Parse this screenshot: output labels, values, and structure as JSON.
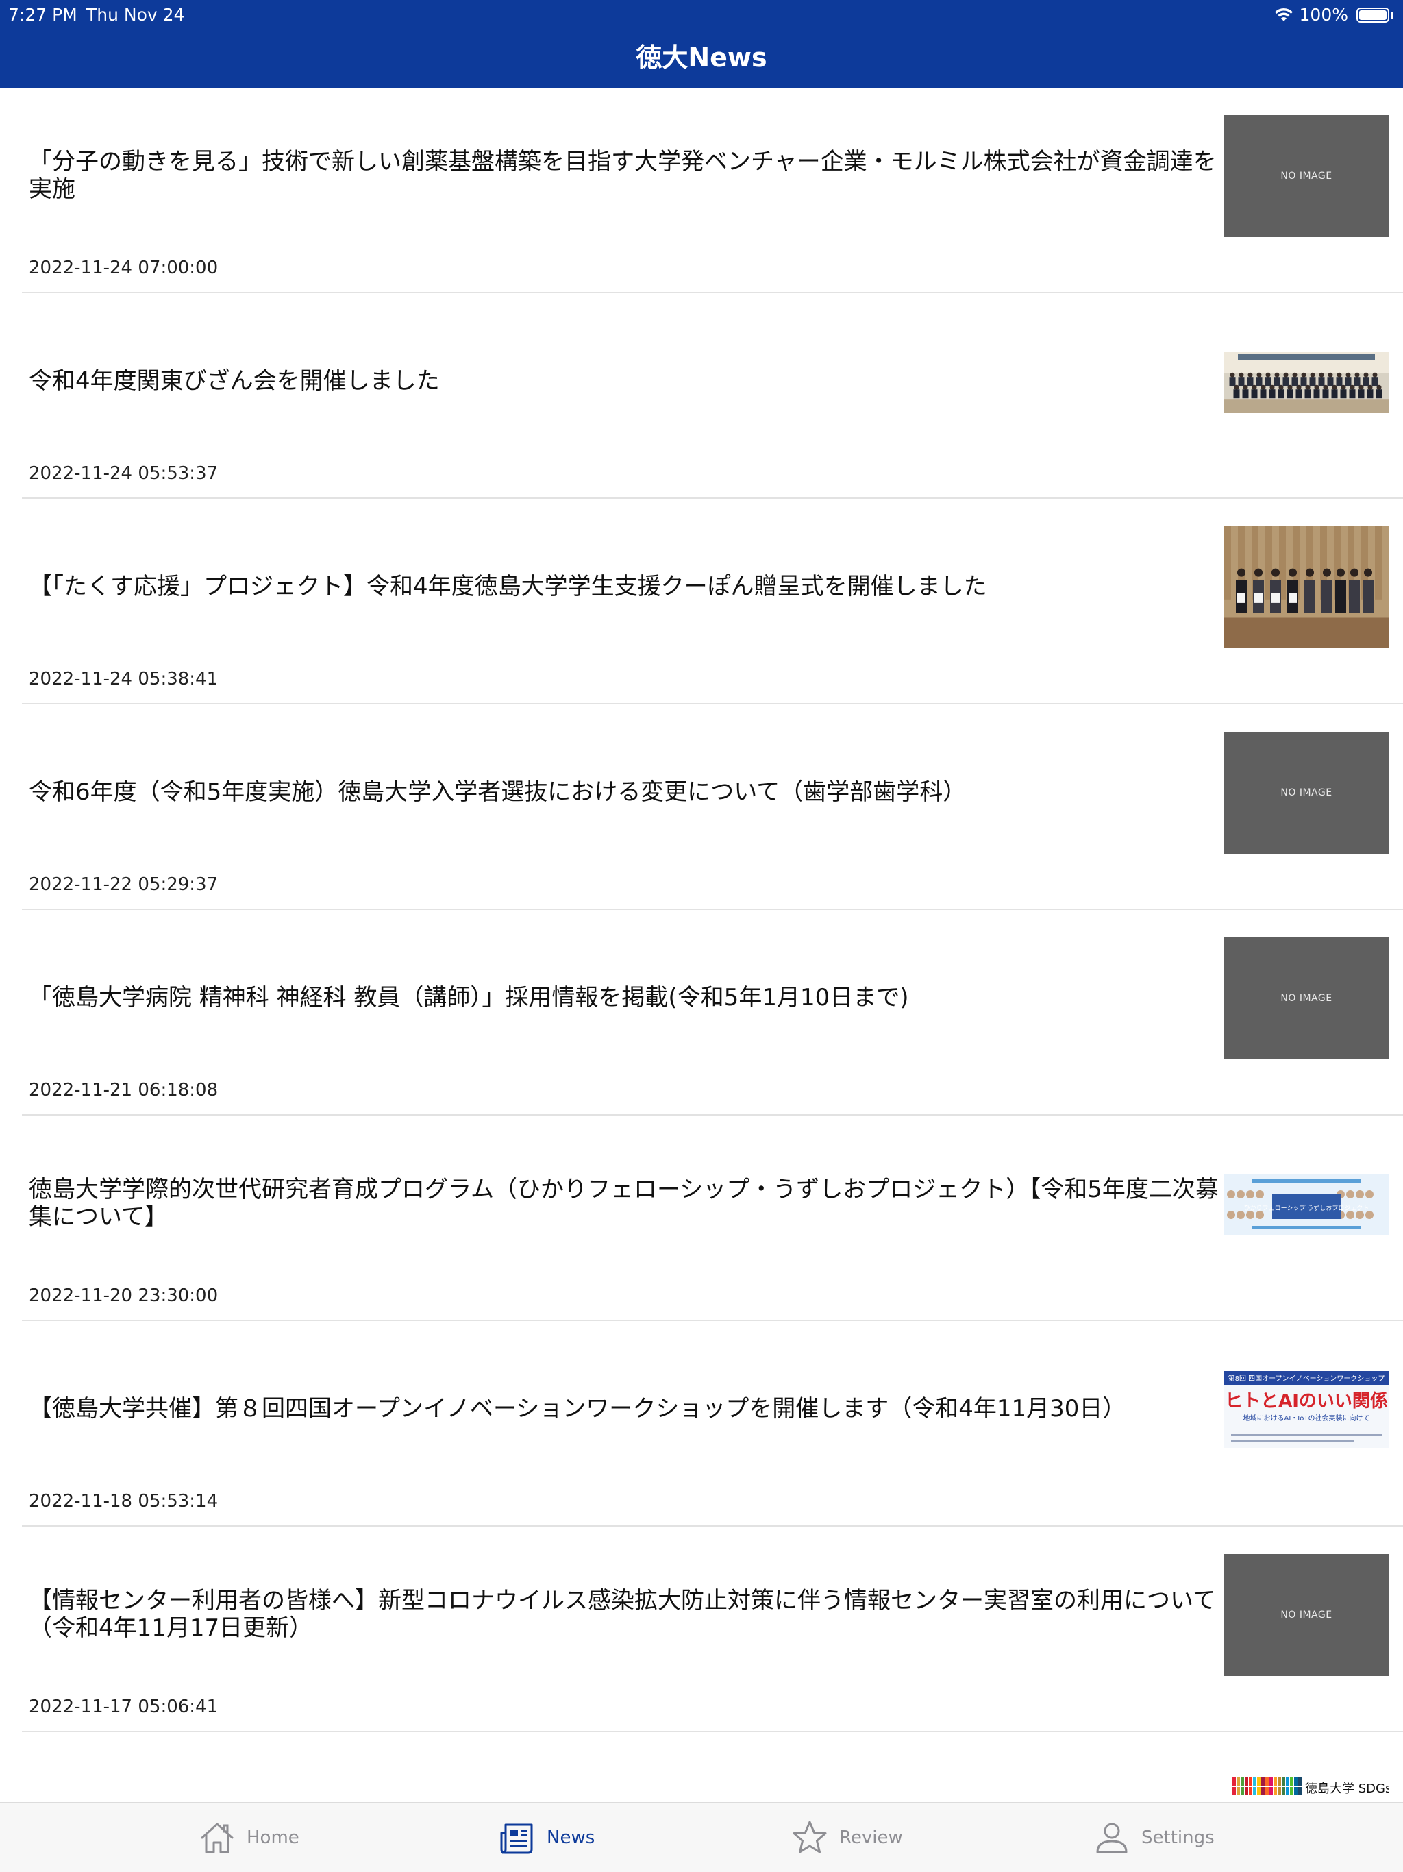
{
  "status_bar": {
    "time": "7:27 PM",
    "date": "Thu Nov 24",
    "battery": "100%",
    "battery_level": 1.0
  },
  "header": {
    "title": "徳大News"
  },
  "news": [
    {
      "title": "「分子の動きを見る」技術で新しい創薬基盤構築を目指す大学発ベンチャー企業・モルミル株式会社が資金調達を実施",
      "date": "2022-11-24 07:00:00",
      "thumb": "no-image",
      "thumb_label": "NO IMAGE"
    },
    {
      "title": "令和4年度関東びざん会を開催しました",
      "date": "2022-11-24 05:53:37",
      "thumb": "group-photo"
    },
    {
      "title": "【「たくす応援」プロジェクト】令和4年度徳島大学学生支援クーぽん贈呈式を開催しました",
      "date": "2022-11-24 05:38:41",
      "thumb": "ceremony-photo"
    },
    {
      "title": "令和6年度（令和5年度実施）徳島大学入学者選抜における変更について（歯学部歯学科）",
      "date": "2022-11-22 05:29:37",
      "thumb": "no-image",
      "thumb_label": "NO IMAGE"
    },
    {
      "title": "「徳島大学病院 精神科 神経科 教員（講師）」採用情報を掲載(令和5年1月10日まで)",
      "date": "2022-11-21 06:18:08",
      "thumb": "no-image",
      "thumb_label": "NO IMAGE"
    },
    {
      "title": "徳島大学学際的次世代研究者育成プログラム（ひかりフェローシップ・うずしおプロジェクト）【令和5年度二次募集について】",
      "date": "2022-11-20 23:30:00",
      "thumb": "fellowship-banner",
      "thumb_text": "ひかりフェローシップ うずしおプロジェクト"
    },
    {
      "title": "【徳島大学共催】第８回四国オープンイノベーションワークショップを開催します（令和4年11月30日）",
      "date": "2022-11-18 05:53:14",
      "thumb": "workshop-banner",
      "thumb_head": "第8回 四国オープンイノベーションワークショップ",
      "thumb_main": "ヒトとAIのいい関係",
      "thumb_sub": "地域におけるAI・IoTの社会実装に向けて"
    },
    {
      "title": "【情報センター利用者の皆様へ】新型コロナウイルス感染拡大防止対策に伴う情報センター実習室の利用について（令和4年11月17日更新）",
      "date": "2022-11-17 05:06:41",
      "thumb": "no-image",
      "thumb_label": "NO IMAGE"
    },
    {
      "title": "",
      "date": "",
      "thumb": "sdgs-banner",
      "thumb_text": "徳島大学 SDGs公開"
    }
  ],
  "tabs": [
    {
      "label": "Home",
      "icon": "house-icon",
      "active": false
    },
    {
      "label": "News",
      "icon": "newspaper-icon",
      "active": true
    },
    {
      "label": "Review",
      "icon": "star-icon",
      "active": false
    },
    {
      "label": "Settings",
      "icon": "person-icon",
      "active": false
    }
  ],
  "colors": {
    "header_bg": "#0d3a9a",
    "tab_active": "#0d3a9a",
    "tab_inactive": "#8e8e93",
    "no_image_bg": "#5f5f5f"
  }
}
